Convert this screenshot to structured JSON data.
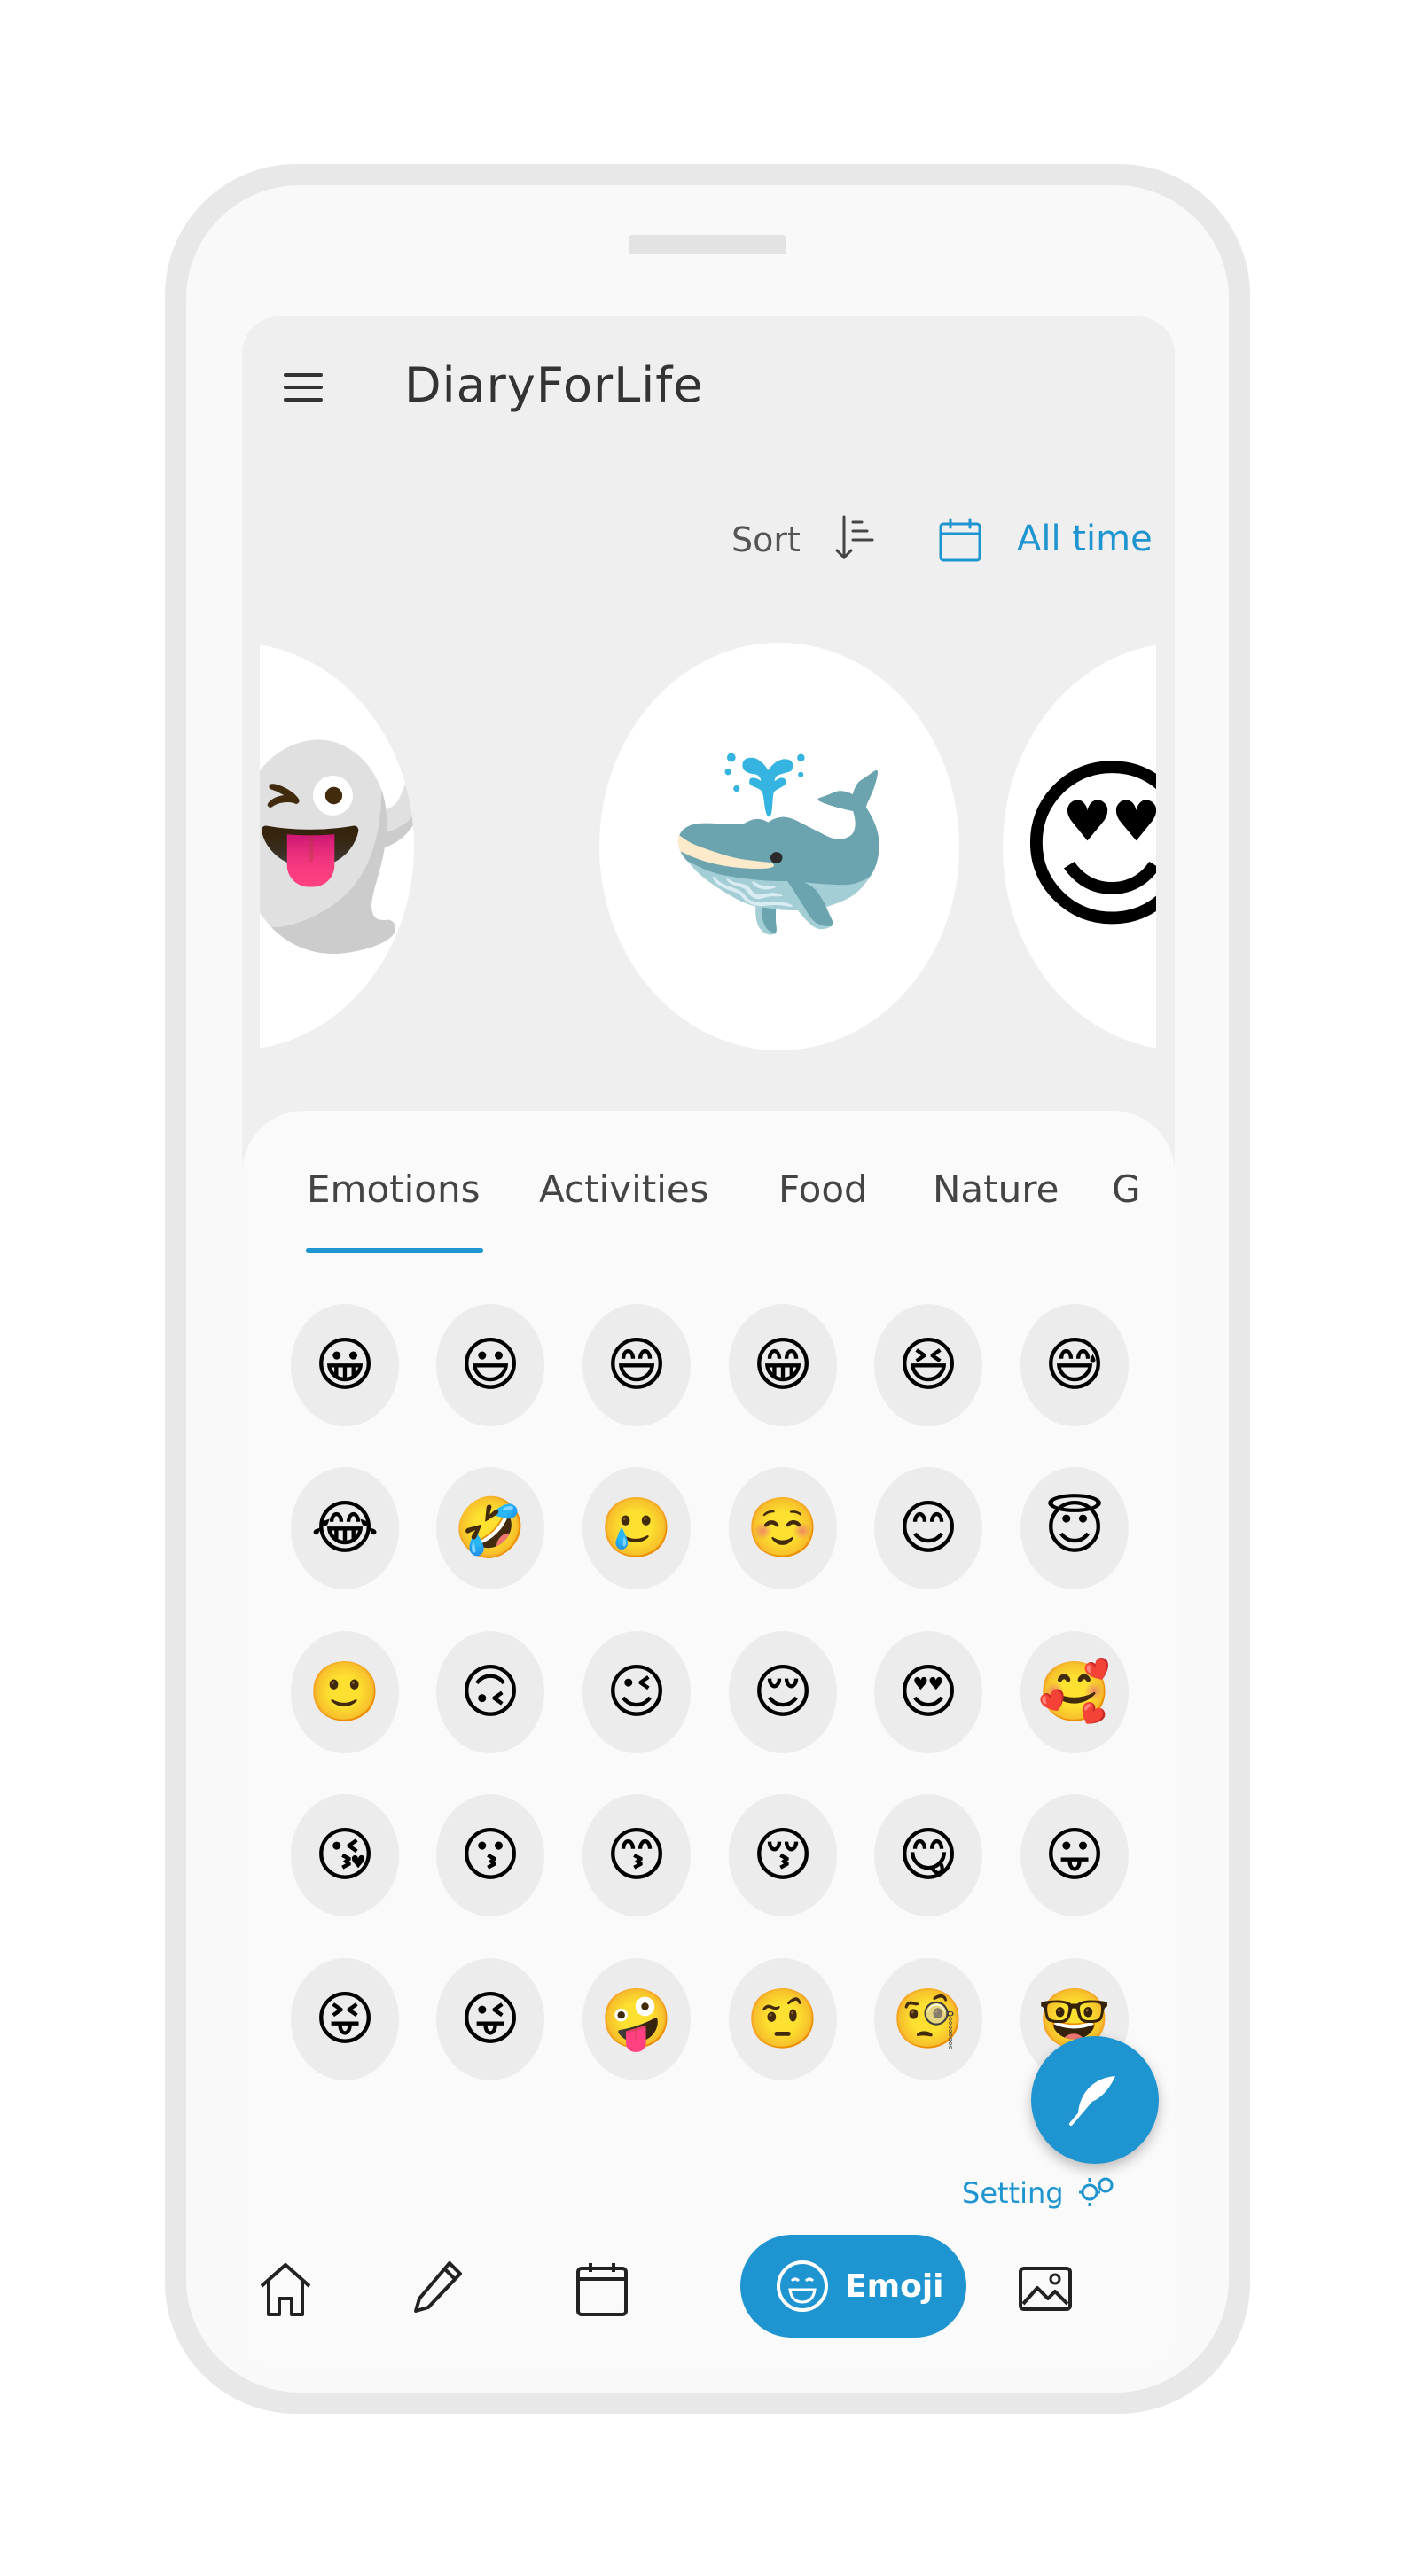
{
  "app": {
    "title": "DiaryForLife"
  },
  "filter": {
    "sort_label": "Sort",
    "range_label": "All time"
  },
  "carousel": [
    {
      "emoji": "👻",
      "name": "ghost"
    },
    {
      "emoji": "🐳",
      "name": "whale"
    },
    {
      "emoji": "😍",
      "name": "heart-eyes"
    }
  ],
  "tabs": [
    "Emotions",
    "Activities",
    "Food",
    "Nature",
    "G"
  ],
  "active_tab": "Emotions",
  "emojis": [
    [
      "😀",
      "😃",
      "😄",
      "😁",
      "😆",
      "😅"
    ],
    [
      "😂",
      "🤣",
      "🥲",
      "☺️",
      "😊",
      "😇"
    ],
    [
      "🙂",
      "🙃",
      "😉",
      "😌",
      "😍",
      "🥰"
    ],
    [
      "😘",
      "😗",
      "😙",
      "😚",
      "😋",
      "😛"
    ],
    [
      "😝",
      "😜",
      "🤪",
      "🤨",
      "🧐",
      "🤓"
    ]
  ],
  "setting": {
    "label": "Setting"
  },
  "bottom_nav": {
    "emoji_label": "Emoji"
  },
  "colors": {
    "accent": "#1e95d0",
    "panel": "#fafafa",
    "header": "#efefef"
  }
}
